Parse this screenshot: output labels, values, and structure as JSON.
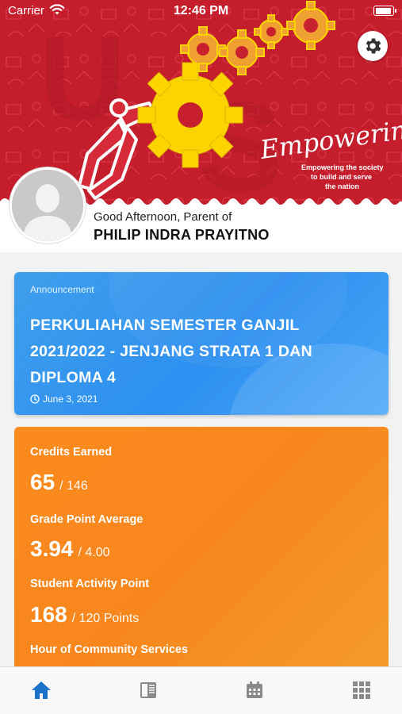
{
  "status_bar": {
    "carrier": "Carrier",
    "time": "12:46 PM"
  },
  "header": {
    "banner_text": "Empowering",
    "banner_subtitle": [
      "Empowering the society",
      "to build and serve",
      "the nation"
    ],
    "greeting": "Good Afternoon, Parent of",
    "parent_name": "PHILIP INDRA PRAYITNO"
  },
  "announcement": {
    "label": "Announcement",
    "title": "PERKULIAHAN SEMESTER GANJIL 2021/2022 - JENJANG STRATA 1 DAN DIPLOMA 4",
    "date": "June 3, 2021"
  },
  "stats": {
    "credits": {
      "label": "Credits Earned",
      "value": "65",
      "total": "/ 146"
    },
    "gpa": {
      "label": "Grade Point Average",
      "value": "3.94",
      "total": "/ 4.00"
    },
    "activity": {
      "label": "Student Activity Point",
      "value": "168",
      "total": "/ 120 Points"
    },
    "community": {
      "label": "Hour of Community Services"
    }
  },
  "tabs": [
    {
      "name": "home-icon",
      "active": true
    },
    {
      "name": "book-icon",
      "active": false
    },
    {
      "name": "calendar-icon",
      "active": false
    },
    {
      "name": "grid-menu-icon",
      "active": false
    }
  ],
  "colors": {
    "banner_red": "#c8202f",
    "gear_yellow": "#fcd400",
    "announcement_blue": "#2d8ff0",
    "stats_orange": "#f7871d",
    "tab_active": "#1a73c8",
    "tab_inactive": "#8a8a8a"
  }
}
